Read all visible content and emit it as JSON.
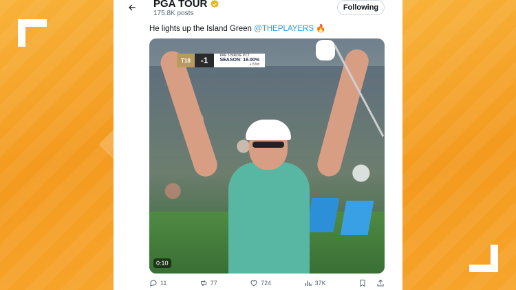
{
  "account": {
    "name": "PGA TOUR",
    "posts_count": "175.8K posts",
    "follow_label": "Following"
  },
  "tweet": {
    "text": "He lights up the Island Green ",
    "mention": "@THEPLAYERS",
    "emoji": "🔥"
  },
  "video": {
    "timestamp": "0:10",
    "scorebug": {
      "position": "T18",
      "score": "-1",
      "stat_title": "PAR 3 BIRDIE PCT",
      "stat_value": "SEASON: 16.00%",
      "stat_rank": "+ 53rd"
    }
  },
  "actions": {
    "replies": "11",
    "reposts": "77",
    "likes": "724",
    "views": "37K"
  },
  "colors": {
    "background_orange": "#f5a229",
    "link_blue": "#1d9bf0",
    "verified_gold": "#e2b719"
  }
}
